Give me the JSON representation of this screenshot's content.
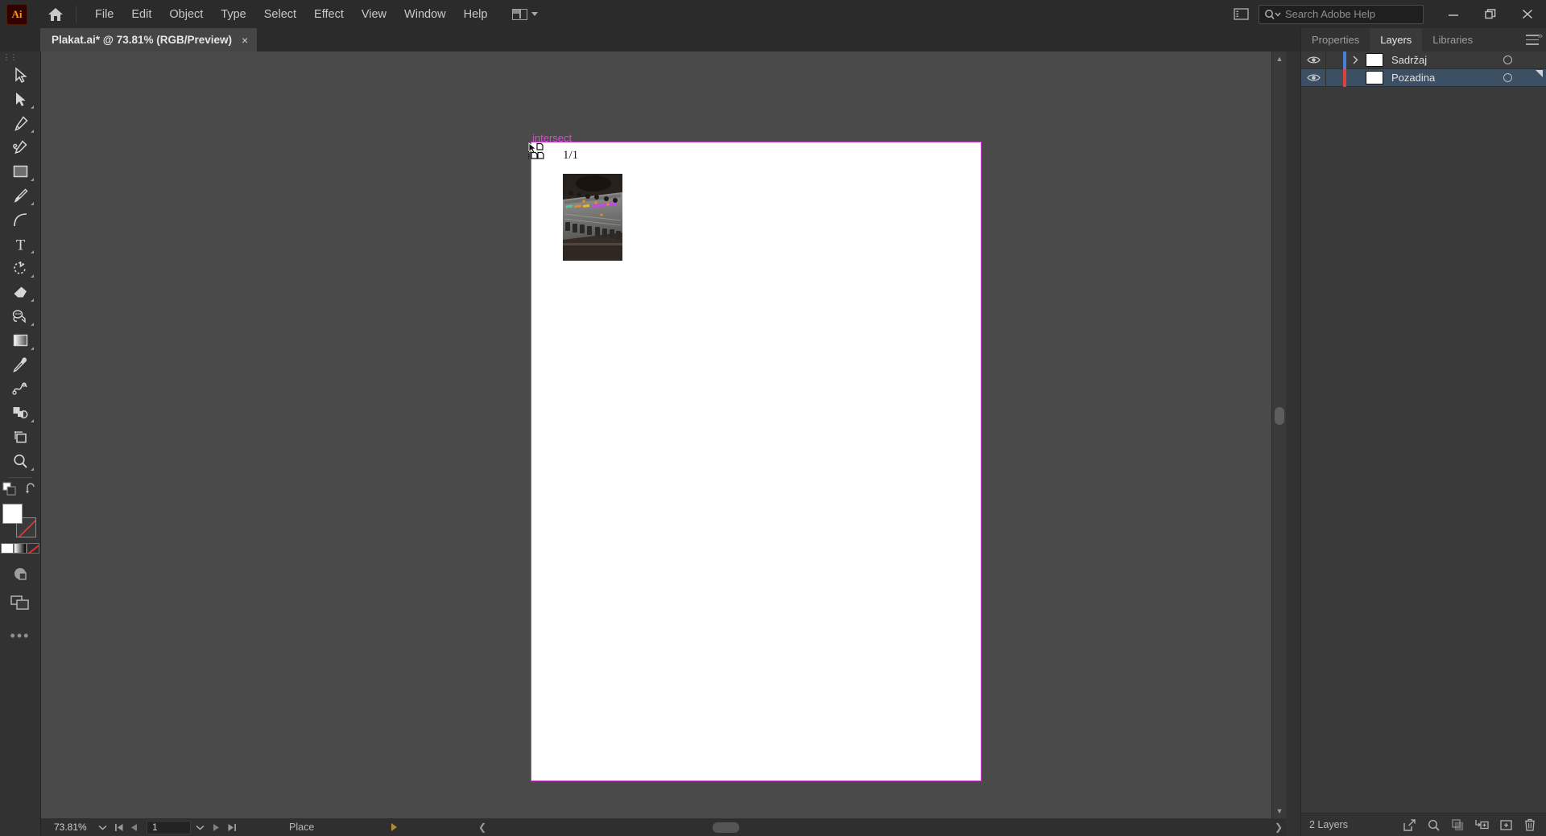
{
  "app": {
    "name": "Adobe Illustrator",
    "logo_text": "Ai",
    "logo_color": "#ff9a00"
  },
  "menubar": {
    "home_icon": "home-icon",
    "items": [
      "File",
      "Edit",
      "Object",
      "Type",
      "Select",
      "Effect",
      "View",
      "Window",
      "Help"
    ],
    "arrange_icon": "arrange-documents-icon",
    "arrange_chevron": "chevron-down-icon",
    "panel_toggle_icon": "panel-toggle-icon",
    "search": {
      "icon": "search-icon",
      "chevron": "chevron-down-icon",
      "placeholder": "Search Adobe Help",
      "value": ""
    },
    "window_controls": {
      "minimize": "minimize-icon",
      "maximize": "restore-icon",
      "close": "close-icon"
    }
  },
  "tabbar": {
    "document_tab": {
      "title": "Plakat.ai* @ 73.81% (RGB/Preview)",
      "close": "×"
    }
  },
  "toolbar": {
    "tools": [
      {
        "name": "selection-tool",
        "glyph": "selection",
        "has_more": false
      },
      {
        "name": "direct-selection-tool",
        "glyph": "direct",
        "has_more": true
      },
      {
        "name": "pen-tool",
        "glyph": "pen",
        "has_more": true
      },
      {
        "name": "curvature-tool",
        "glyph": "curvature",
        "has_more": false
      },
      {
        "name": "rectangle-tool",
        "glyph": "rectangle",
        "has_more": true
      },
      {
        "name": "paintbrush-tool",
        "glyph": "paintbrush",
        "has_more": true
      },
      {
        "name": "arc-tool",
        "glyph": "arc",
        "has_more": false
      },
      {
        "name": "type-tool",
        "glyph": "type",
        "has_more": true
      },
      {
        "name": "rotate-tool",
        "glyph": "rotate",
        "has_more": true
      },
      {
        "name": "eraser-tool",
        "glyph": "eraser",
        "has_more": true
      },
      {
        "name": "scale-tool",
        "glyph": "scale",
        "has_more": true
      },
      {
        "name": "gradient-tool",
        "glyph": "gradient",
        "has_more": true
      },
      {
        "name": "eyedropper-tool",
        "glyph": "eyedropper",
        "has_more": false
      },
      {
        "name": "blend-tool",
        "glyph": "blend",
        "has_more": false
      },
      {
        "name": "shape-builder-tool",
        "glyph": "shapebuilder",
        "has_more": true
      },
      {
        "name": "artboard-tool",
        "glyph": "artboard",
        "has_more": false
      },
      {
        "name": "zoom-tool",
        "glyph": "zoom",
        "has_more": true
      }
    ],
    "swap_fill_stroke_icon": "swap-fill-stroke-icon",
    "default_fill_stroke_icon": "default-fill-stroke-icon",
    "fill_color": "#ffffff",
    "stroke_color": "none",
    "color_modes": [
      "color-swatch",
      "gradient-swatch",
      "none-swatch"
    ],
    "draw_mode_icon": "draw-mode-icon",
    "screen_mode_icon": "screen-mode-icon",
    "more_tools": "•••"
  },
  "canvas": {
    "artboard_label": "intersect",
    "artboard_label_color": "#cc3fcc",
    "artboard_border_color": "#cc3fcc",
    "page_count": "1/1",
    "cursor_icon": "place-image-cursor",
    "placed_image_name": "audio-mixing-console-photo"
  },
  "statusbar": {
    "zoom_level": "73.81%",
    "zoom_chevron": "chevron-down-icon",
    "first_page_icon": "first-page-icon",
    "prev_page_icon": "prev-page-icon",
    "page_number": "1",
    "page_chevron": "chevron-down-icon",
    "next_page_icon": "next-page-icon",
    "last_page_icon": "last-page-icon",
    "status_text": "Place",
    "status_arrow_icon": "play-arrow-icon"
  },
  "scrollbars": {
    "vertical_up_icon": "chevron-up-icon",
    "vertical_down_icon": "chevron-down-icon",
    "horizontal_left_icon": "chevron-left-icon",
    "horizontal_right_icon": "chevron-right-icon"
  },
  "rightpanel": {
    "tabs": [
      {
        "label": "Properties",
        "active": false
      },
      {
        "label": "Layers",
        "active": true
      },
      {
        "label": "Libraries",
        "active": false
      }
    ],
    "menu_icon": "panel-menu-icon",
    "collapse_icon": "collapse-panel-icon",
    "layers": [
      {
        "name": "Sadržaj",
        "visible": true,
        "locked": false,
        "color": "#4b7fd6",
        "selected": false,
        "expandable": true,
        "expand_icon": "chevron-right-icon",
        "eye_icon": "eye-icon",
        "target_icon": "target-circle-icon"
      },
      {
        "name": "Pozadina",
        "visible": true,
        "locked": false,
        "color": "#e0413c",
        "selected": true,
        "expandable": false,
        "expand_icon": "",
        "eye_icon": "eye-icon",
        "target_icon": "target-circle-icon"
      }
    ],
    "footer": {
      "count_label": "2 Layers",
      "icons": [
        "release-to-layers-icon",
        "locate-object-icon",
        "make-clipping-mask-icon",
        "create-sublayer-icon",
        "create-new-layer-icon",
        "delete-selection-icon"
      ]
    }
  }
}
